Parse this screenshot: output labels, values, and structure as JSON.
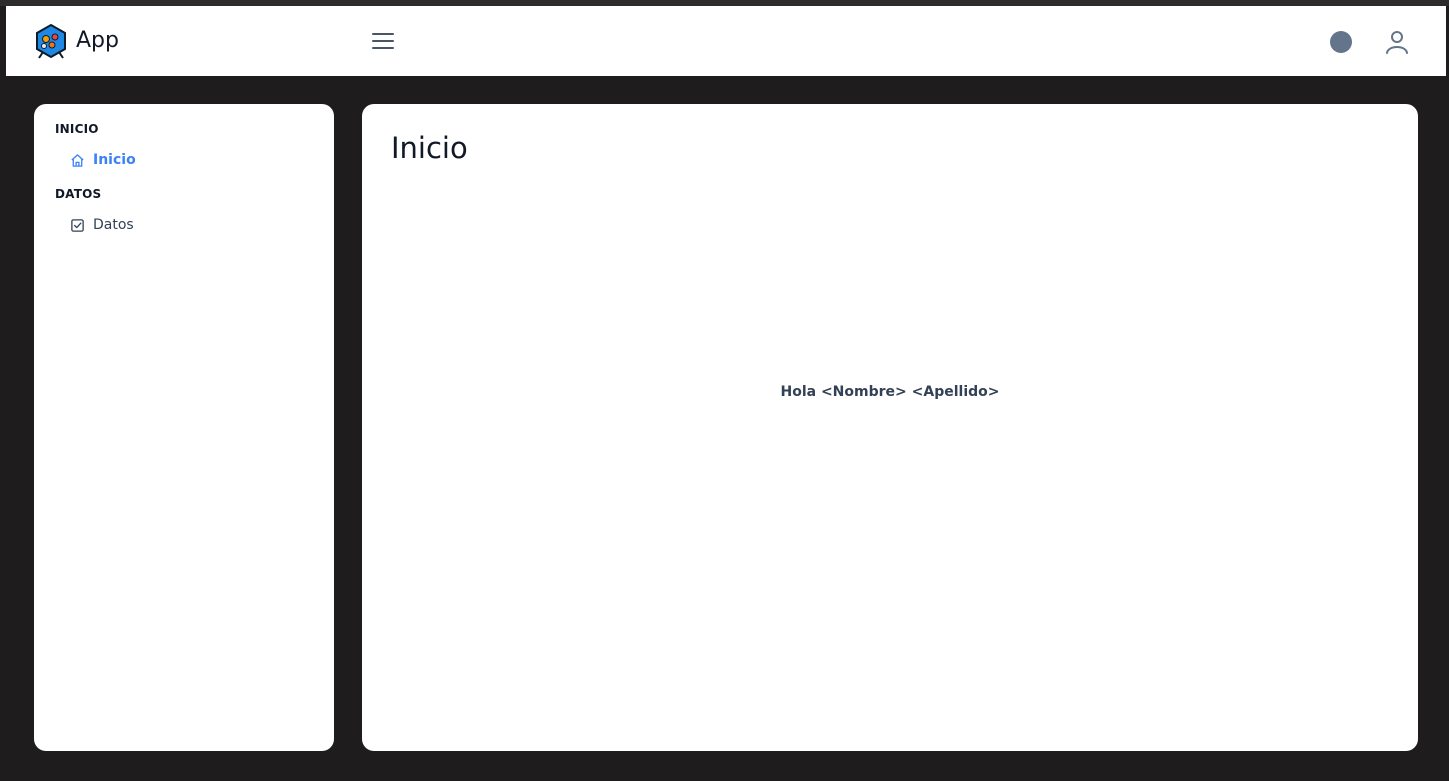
{
  "header": {
    "app_name": "App",
    "logo_icon": "hexagon-logo-icon",
    "menu_icon": "hamburger-icon",
    "theme_icon": "circle-icon",
    "user_icon": "user-icon"
  },
  "sidebar": {
    "sections": [
      {
        "title": "INICIO",
        "items": [
          {
            "label": "Inicio",
            "icon": "home-icon",
            "active": true
          }
        ]
      },
      {
        "title": "DATOS",
        "items": [
          {
            "label": "Datos",
            "icon": "checkbox-icon",
            "active": false
          }
        ]
      }
    ]
  },
  "main": {
    "title": "Inicio",
    "greeting": "Hola <Nombre> <Apellido>"
  },
  "colors": {
    "accent": "#3b82f6",
    "background": "#1e1c1d",
    "surface": "#ffffff",
    "text": "#111827",
    "muted": "#64748b"
  }
}
